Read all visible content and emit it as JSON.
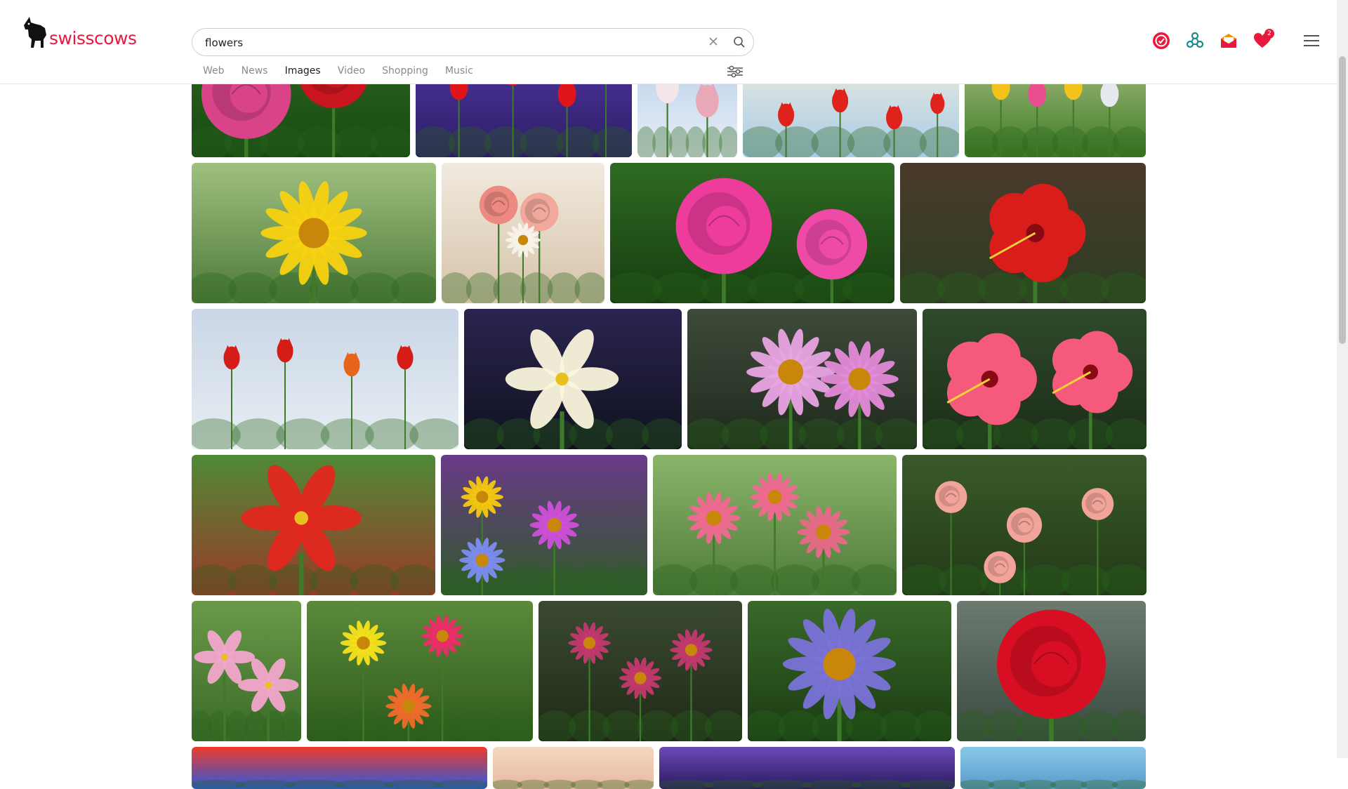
{
  "brand": {
    "name": "swisscows"
  },
  "search": {
    "query": "flowers",
    "placeholder": ""
  },
  "tabs": [
    {
      "label": "Web"
    },
    {
      "label": "News"
    },
    {
      "label": "Images",
      "active": true
    },
    {
      "label": "Video"
    },
    {
      "label": "Shopping"
    },
    {
      "label": "Music"
    }
  ],
  "notifications": {
    "favorites_count": "2"
  },
  "colors": {
    "brand": "#e8193d",
    "teal": "#1a8a8a",
    "orange": "#f39200"
  },
  "icons": [
    "vpn-icon",
    "network-icon",
    "mail-icon",
    "heart-icon",
    "menu-icon",
    "filters-icon",
    "search-icon",
    "clear-icon"
  ],
  "images": [
    {
      "id": "pink-red-roses",
      "desc": "pink and red roses",
      "row": 0
    },
    {
      "id": "red-tulips-purple-hyacinth",
      "desc": "red tulips with purple hyacinths",
      "row": 0
    },
    {
      "id": "white-pink-tulips",
      "desc": "white and pink tulips",
      "row": 0
    },
    {
      "id": "red-tulips-sun",
      "desc": "red tulips against sun",
      "row": 0
    },
    {
      "id": "yellow-tulips-field",
      "desc": "yellow and red tulip field",
      "row": 0
    },
    {
      "id": "yellow-daisy",
      "desc": "yellow daisy",
      "row": 1
    },
    {
      "id": "rose-bouquet-jug",
      "desc": "rose bouquet in jug",
      "row": 1
    },
    {
      "id": "pink-roses",
      "desc": "pink roses",
      "row": 1
    },
    {
      "id": "red-hibiscus",
      "desc": "red hibiscus",
      "row": 1
    },
    {
      "id": "tulip-field-mountain",
      "desc": "red tulip field with mountains",
      "row": 2
    },
    {
      "id": "white-lily",
      "desc": "white lily",
      "row": 2
    },
    {
      "id": "pink-dahlias",
      "desc": "pink dahlias",
      "row": 2
    },
    {
      "id": "pink-hibiscus",
      "desc": "pink hibiscus",
      "row": 2
    },
    {
      "id": "red-tiger-lily",
      "desc": "red tiger lily",
      "row": 3
    },
    {
      "id": "mixed-spring-flowers",
      "desc": "mixed spring flowers",
      "row": 3
    },
    {
      "id": "pink-strawflowers",
      "desc": "pink strawflowers",
      "row": 3
    },
    {
      "id": "peach-roses",
      "desc": "peach roses",
      "row": 3
    },
    {
      "id": "pink-alstroemeria",
      "desc": "pink alstroemeria",
      "row": 4
    },
    {
      "id": "gerbera-bouquet",
      "desc": "gerbera bouquet",
      "row": 4
    },
    {
      "id": "sweet-william",
      "desc": "sweet william flowers",
      "row": 4
    },
    {
      "id": "passion-flower",
      "desc": "passion flower",
      "row": 4
    },
    {
      "id": "red-rose",
      "desc": "red rose",
      "row": 4
    },
    {
      "id": "rainbow-flowers",
      "desc": "colorful flowers",
      "row": 5
    },
    {
      "id": "peach-flower",
      "desc": "peach flower",
      "row": 5
    },
    {
      "id": "purple-flowers",
      "desc": "purple flowers",
      "row": 5
    },
    {
      "id": "blue-flower",
      "desc": "blue flower",
      "row": 5
    }
  ]
}
